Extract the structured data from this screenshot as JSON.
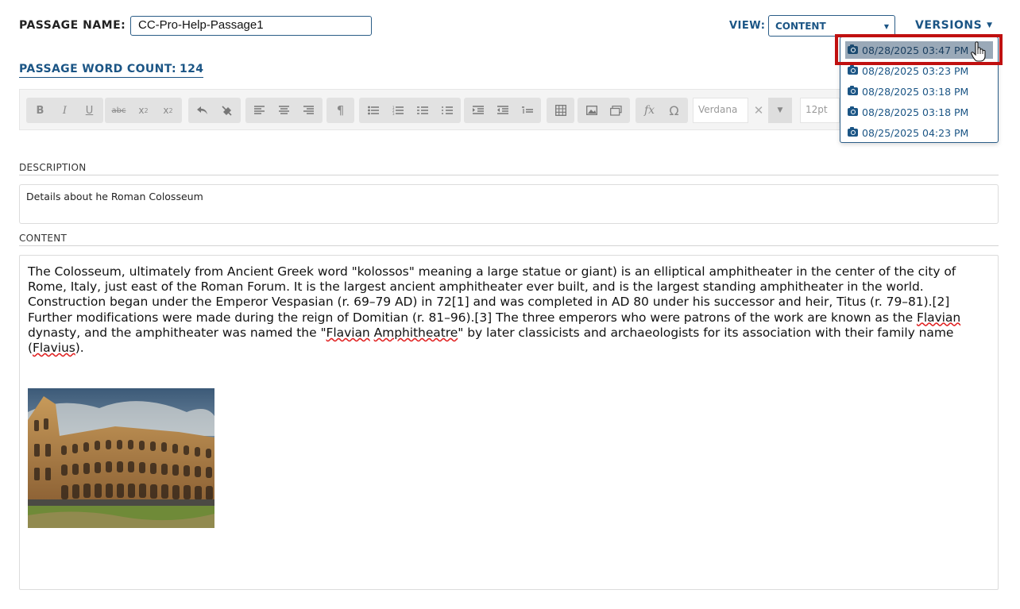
{
  "header": {
    "passage_name_label": "PASSAGE NAME:",
    "passage_name_value": "CC-Pro-Help-Passage1",
    "view_label": "VIEW:",
    "view_value": "CONTENT",
    "versions_label": "VERSIONS",
    "word_count_label": "PASSAGE WORD COUNT:",
    "word_count_value": "124"
  },
  "toolbar": {
    "font_family_value": "Verdana",
    "font_size_value": "12pt",
    "icons": [
      "bold-icon",
      "italic-icon",
      "underline-icon",
      "strikethrough-icon",
      "subscript-icon",
      "superscript-icon",
      "undo-icon",
      "clear-format-icon",
      "align-left-icon",
      "align-center-icon",
      "align-right-icon",
      "paragraph-icon",
      "bullet-list-icon",
      "numbered-list-icon",
      "alpha-list-icon",
      "roman-list-icon",
      "indent-icon",
      "outdent-icon",
      "line-height-icon",
      "table-icon",
      "image-icon",
      "gallery-icon",
      "formula-icon",
      "omega-icon"
    ]
  },
  "versions": {
    "items": [
      {
        "label": "08/28/2025 03:47 PM",
        "selected": true
      },
      {
        "label": "08/28/2025 03:23 PM",
        "selected": false
      },
      {
        "label": "08/28/2025 03:18 PM",
        "selected": false
      },
      {
        "label": "08/28/2025 03:18 PM",
        "selected": false
      },
      {
        "label": "08/25/2025 04:23 PM",
        "selected": false
      }
    ]
  },
  "description": {
    "label": "DESCRIPTION",
    "value": "Details about he Roman Colosseum"
  },
  "content": {
    "label": "CONTENT",
    "body_parts": [
      "The Colosseum, ultimately from Ancient Greek word \"kolossos\" meaning a large statue or giant) is an elliptical amphitheater in the center of the city of Rome, Italy, just east of the Roman Forum. It is the largest ancient amphitheater ever built, and is the largest standing amphitheater in the world. Construction began under the Emperor Vespasian (r. 69–79 AD) in 72[1] and was completed in AD 80 under his successor and heir, Titus (r. 79–81).[2] Further modifications were made during the reign of Domitian (r. 81–96).[3] The three emperors who were patrons of the work are known as the ",
      "Flavian",
      " dynasty, and the amphitheater was named the \"",
      "Flavian",
      " ",
      "Amphitheatre",
      "\" by later classicists and archaeologists for its association with their family name (",
      "Flavius",
      ")."
    ]
  },
  "colors": {
    "accent": "#1b5585",
    "highlight_border": "#c01010",
    "selected_item_bg": "#9aa9b8"
  }
}
